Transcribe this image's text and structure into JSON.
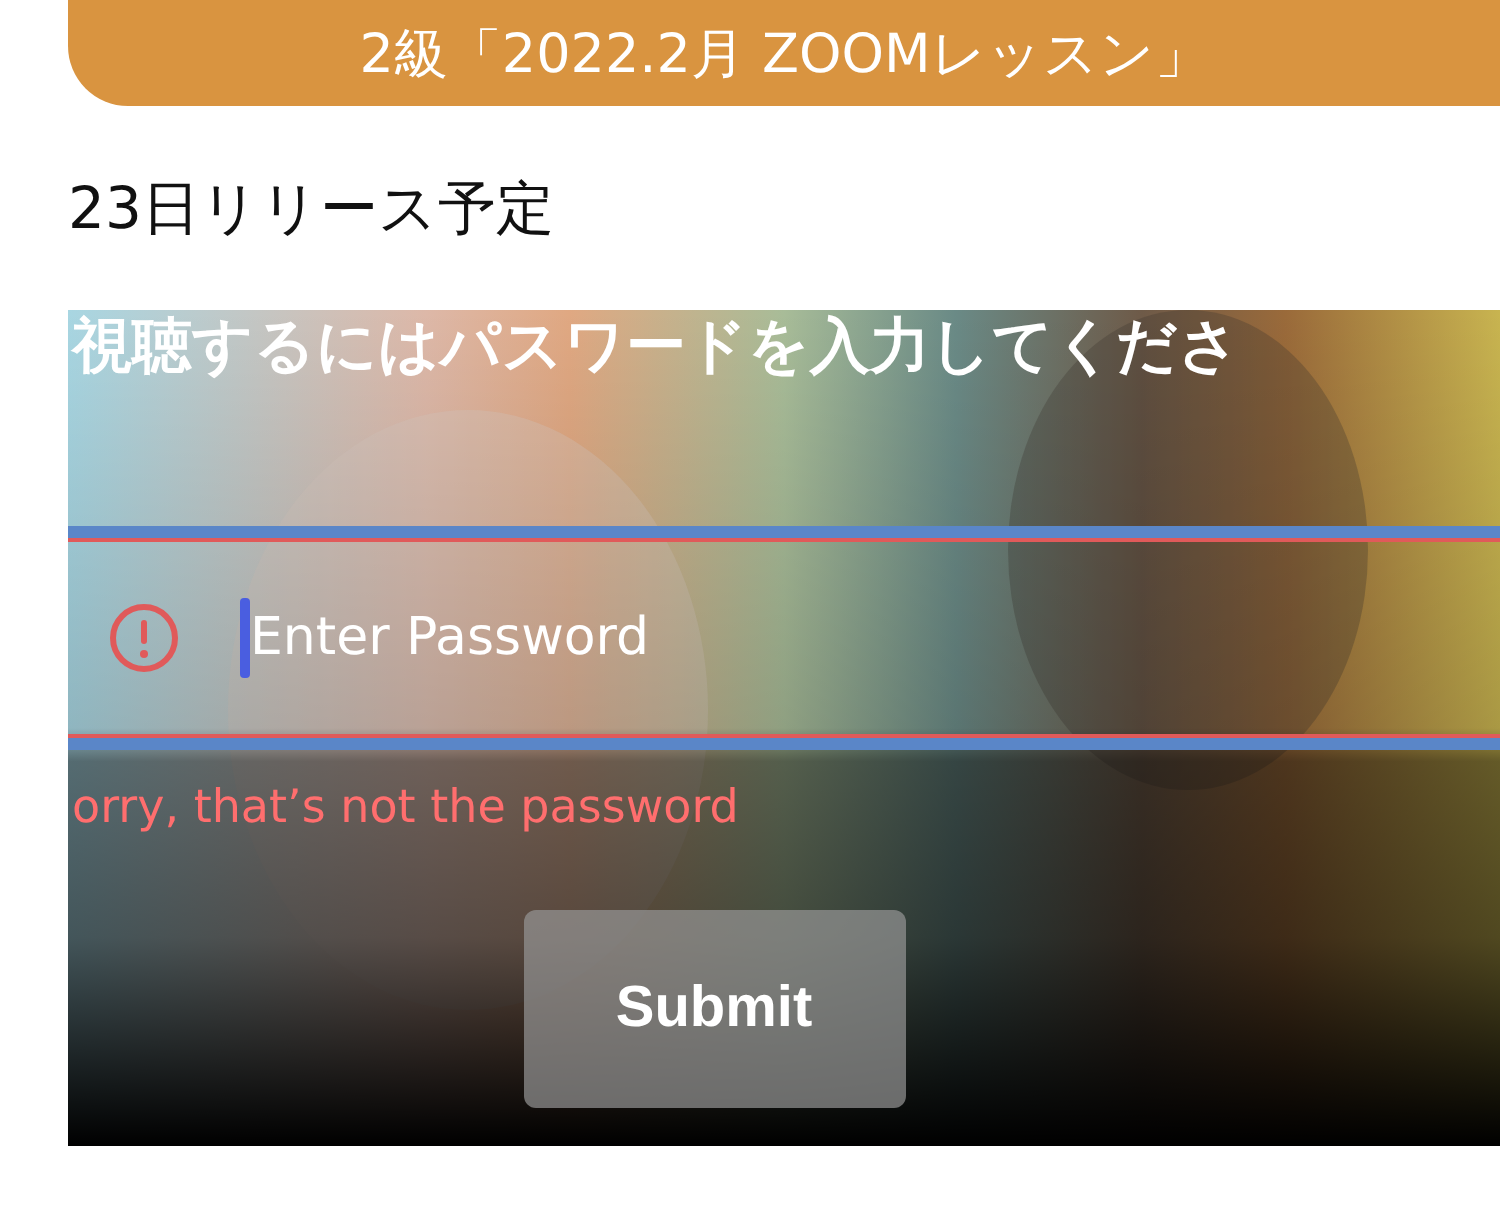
{
  "header": {
    "title": "2級「2022.2月 ZOOMレッスン」"
  },
  "subtitle": "23日リリース予定",
  "video": {
    "prompt": "視聴するにはパスワードを入力してくださ",
    "password_field": {
      "placeholder": "Enter Password",
      "invalid": true
    },
    "error": "orry, that’s not the password",
    "submit": "Submit"
  }
}
